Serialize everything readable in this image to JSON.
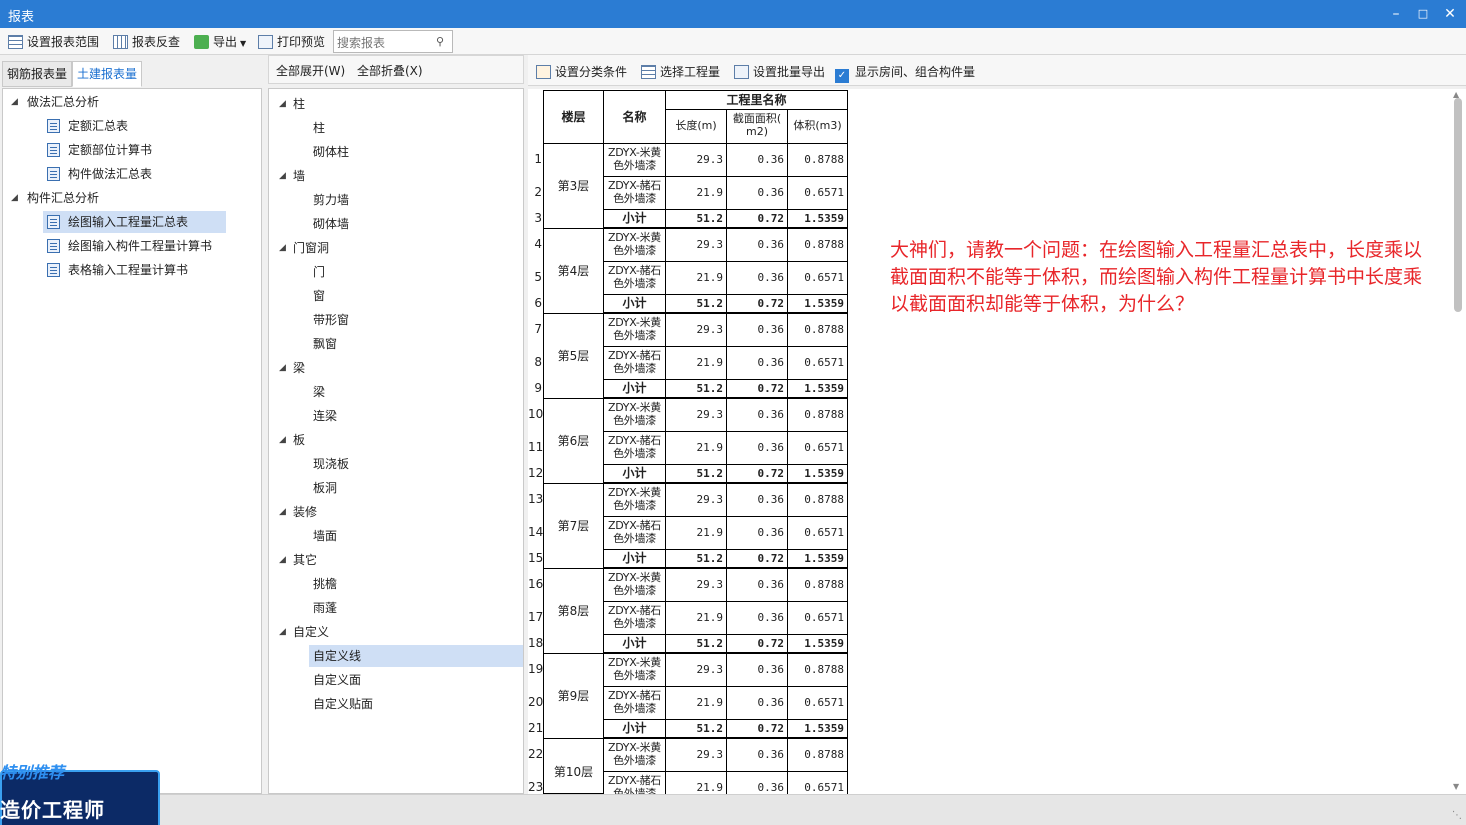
{
  "window": {
    "title": "报表"
  },
  "toolbar": {
    "set_range": "设置报表范围",
    "reverse_check": "报表反查",
    "export": "导出",
    "print_preview": "打印预览",
    "search_placeholder": "搜索报表"
  },
  "left_tabs": {
    "rebar": "钢筋报表量",
    "civil": "土建报表量"
  },
  "left_tree": {
    "group1": "做法汇总分析",
    "g1_items": [
      "定额汇总表",
      "定额部位计算书",
      "构件做法汇总表"
    ],
    "group2": "构件汇总分析",
    "g2_items": [
      "绘图输入工程量汇总表",
      "绘图输入构件工程量计算书",
      "表格输入工程量计算书"
    ]
  },
  "mid_header": {
    "expand_all": "全部展开(W)",
    "collapse_all": "全部折叠(X)"
  },
  "mid_tree": [
    {
      "label": "柱",
      "children": [
        "柱",
        "砌体柱"
      ]
    },
    {
      "label": "墙",
      "children": [
        "剪力墙",
        "砌体墙"
      ]
    },
    {
      "label": "门窗洞",
      "children": [
        "门",
        "窗",
        "带形窗",
        "飘窗"
      ]
    },
    {
      "label": "梁",
      "children": [
        "梁",
        "连梁"
      ]
    },
    {
      "label": "板",
      "children": [
        "现浇板",
        "板洞"
      ]
    },
    {
      "label": "装修",
      "children": [
        "墙面"
      ]
    },
    {
      "label": "其它",
      "children": [
        "挑檐",
        "雨蓬"
      ]
    },
    {
      "label": "自定义",
      "children": [
        "自定义线",
        "自定义面",
        "自定义贴面"
      ]
    }
  ],
  "right_header": {
    "classify": "设置分类条件",
    "select_qty": "选择工程量",
    "batch_export": "设置批量导出",
    "show_rooms": "显示房间、组合构件量"
  },
  "table": {
    "header": {
      "floor": "楼层",
      "name": "名称",
      "qty_group": "工程里名称",
      "length": "长度(m)",
      "area_l1": "截面面积(",
      "area_l2": "m2)",
      "volume": "体积(m3)"
    },
    "row_numbers": [
      "1",
      "2",
      "3",
      "4",
      "5",
      "6",
      "7",
      "8",
      "9",
      "10",
      "11",
      "12",
      "13",
      "14",
      "15",
      "16",
      "17",
      "18",
      "19",
      "20",
      "21",
      "22",
      "23"
    ],
    "floors": [
      {
        "floor": "第3层",
        "rows": [
          {
            "name_l1": "ZDYX-米黄",
            "name_l2": "色外墙漆",
            "length": "29.3",
            "area": "0.36",
            "volume": "0.8788"
          },
          {
            "name_l1": "ZDYX-赭石",
            "name_l2": "色外墙漆",
            "length": "21.9",
            "area": "0.36",
            "volume": "0.6571"
          }
        ],
        "subtotal": {
          "label": "小计",
          "length": "51.2",
          "area": "0.72",
          "volume": "1.5359"
        }
      },
      {
        "floor": "第4层",
        "rows": [
          {
            "name_l1": "ZDYX-米黄",
            "name_l2": "色外墙漆",
            "length": "29.3",
            "area": "0.36",
            "volume": "0.8788"
          },
          {
            "name_l1": "ZDYX-赭石",
            "name_l2": "色外墙漆",
            "length": "21.9",
            "area": "0.36",
            "volume": "0.6571"
          }
        ],
        "subtotal": {
          "label": "小计",
          "length": "51.2",
          "area": "0.72",
          "volume": "1.5359"
        }
      },
      {
        "floor": "第5层",
        "rows": [
          {
            "name_l1": "ZDYX-米黄",
            "name_l2": "色外墙漆",
            "length": "29.3",
            "area": "0.36",
            "volume": "0.8788"
          },
          {
            "name_l1": "ZDYX-赭石",
            "name_l2": "色外墙漆",
            "length": "21.9",
            "area": "0.36",
            "volume": "0.6571"
          }
        ],
        "subtotal": {
          "label": "小计",
          "length": "51.2",
          "area": "0.72",
          "volume": "1.5359"
        }
      },
      {
        "floor": "第6层",
        "rows": [
          {
            "name_l1": "ZDYX-米黄",
            "name_l2": "色外墙漆",
            "length": "29.3",
            "area": "0.36",
            "volume": "0.8788"
          },
          {
            "name_l1": "ZDYX-赭石",
            "name_l2": "色外墙漆",
            "length": "21.9",
            "area": "0.36",
            "volume": "0.6571"
          }
        ],
        "subtotal": {
          "label": "小计",
          "length": "51.2",
          "area": "0.72",
          "volume": "1.5359"
        }
      },
      {
        "floor": "第7层",
        "rows": [
          {
            "name_l1": "ZDYX-米黄",
            "name_l2": "色外墙漆",
            "length": "29.3",
            "area": "0.36",
            "volume": "0.8788"
          },
          {
            "name_l1": "ZDYX-赭石",
            "name_l2": "色外墙漆",
            "length": "21.9",
            "area": "0.36",
            "volume": "0.6571"
          }
        ],
        "subtotal": {
          "label": "小计",
          "length": "51.2",
          "area": "0.72",
          "volume": "1.5359"
        }
      },
      {
        "floor": "第8层",
        "rows": [
          {
            "name_l1": "ZDYX-米黄",
            "name_l2": "色外墙漆",
            "length": "29.3",
            "area": "0.36",
            "volume": "0.8788"
          },
          {
            "name_l1": "ZDYX-赭石",
            "name_l2": "色外墙漆",
            "length": "21.9",
            "area": "0.36",
            "volume": "0.6571"
          }
        ],
        "subtotal": {
          "label": "小计",
          "length": "51.2",
          "area": "0.72",
          "volume": "1.5359"
        }
      },
      {
        "floor": "第9层",
        "rows": [
          {
            "name_l1": "ZDYX-米黄",
            "name_l2": "色外墙漆",
            "length": "29.3",
            "area": "0.36",
            "volume": "0.8788"
          },
          {
            "name_l1": "ZDYX-赭石",
            "name_l2": "色外墙漆",
            "length": "21.9",
            "area": "0.36",
            "volume": "0.6571"
          }
        ],
        "subtotal": {
          "label": "小计",
          "length": "51.2",
          "area": "0.72",
          "volume": "1.5359"
        }
      },
      {
        "floor": "第10层",
        "rows": [
          {
            "name_l1": "ZDYX-米黄",
            "name_l2": "色外墙漆",
            "length": "29.3",
            "area": "0.36",
            "volume": "0.8788"
          },
          {
            "name_l1": "ZDYX-赭石",
            "name_l2": "色外墙漆",
            "length": "21.9",
            "area": "0.36",
            "volume": "0.6571"
          }
        ],
        "subtotal": null
      }
    ]
  },
  "annotation": "大神们，请教一个问题：在绘图输入工程量汇总表中，长度乘以截面面积不能等于体积，而绘图输入构件工程量计算书中长度乘以截面面积却能等于体积，为什么？",
  "ad": {
    "line1": "特别推荐",
    "line2": "造价工程师"
  },
  "colors": {
    "titlebar": "#2b7cd3",
    "selected": "#cfdff5",
    "annotation": "#e8262a"
  }
}
